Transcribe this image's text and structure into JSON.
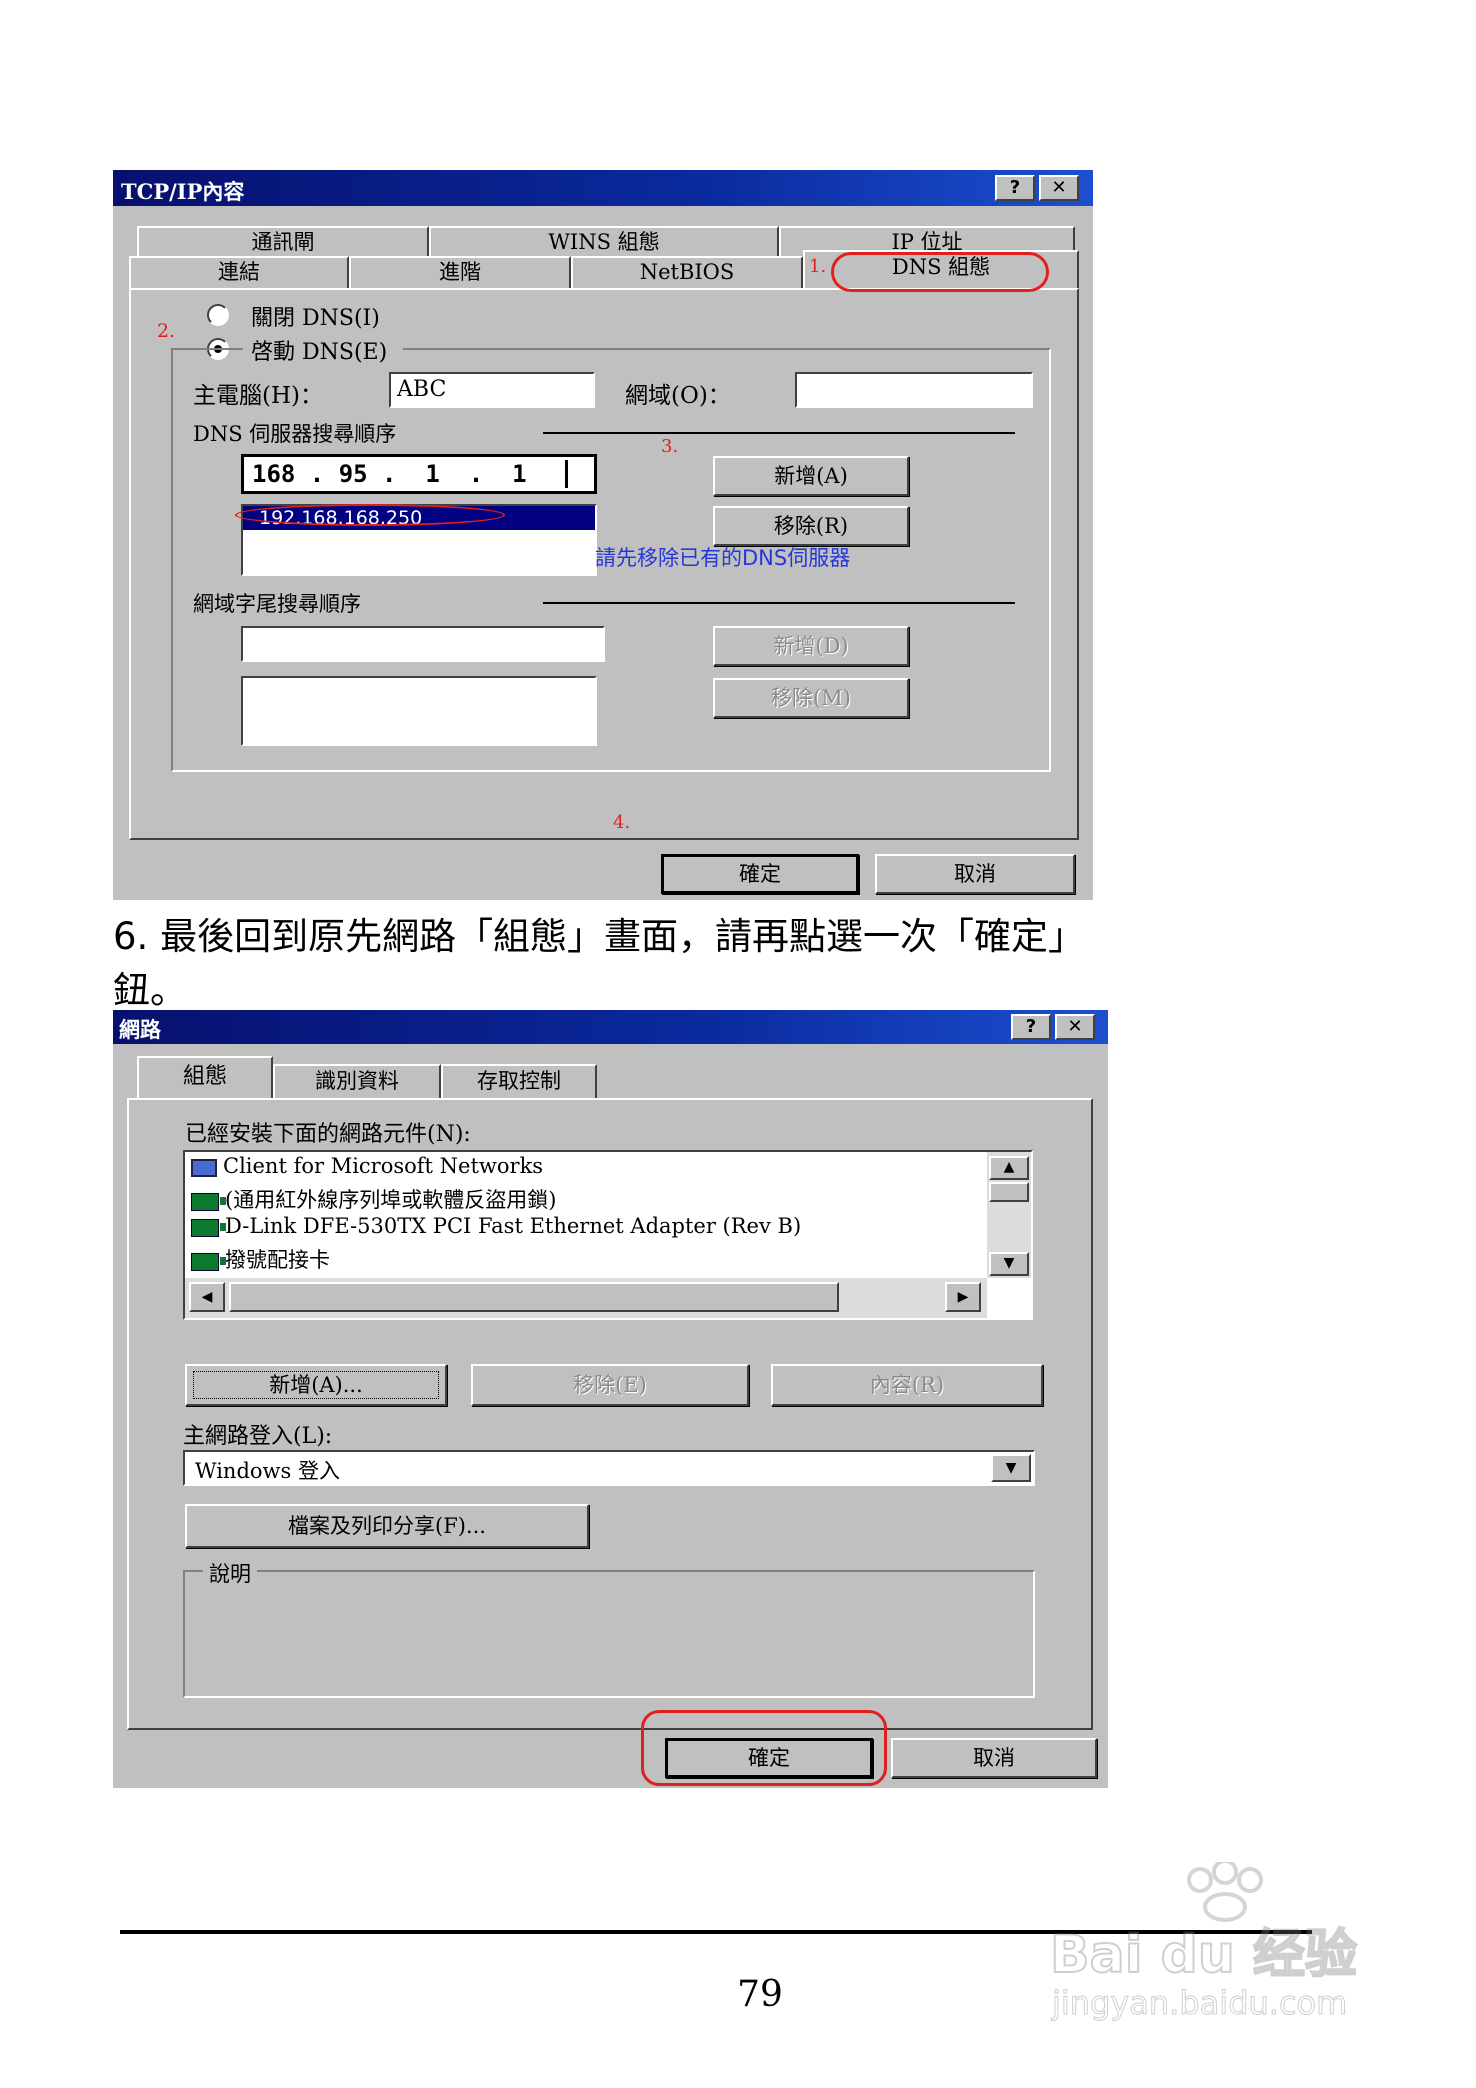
{
  "dialog1": {
    "title": "TCP/IP內容",
    "help": "?",
    "close": "✕",
    "tabs_back": [
      "通訊閘",
      "WINS 組態",
      "IP 位址"
    ],
    "tabs_front": [
      "連結",
      "進階",
      "NetBIOS",
      "DNS 組態"
    ],
    "disable_dns": "關閉 DNS(I)",
    "enable_dns": "啓動 DNS(E)",
    "host_label": "主電腦(H)：",
    "host_value": "ABC",
    "domain_label": "網域(O)：",
    "domain_value": "",
    "dns_order_label": "DNS 伺服器搜尋順序",
    "dns_input": "168 . 95 .  1  .  1",
    "dns_list": [
      "192.168.168.250"
    ],
    "add_button": "新增(A)",
    "remove_button": "移除(R)",
    "note": "請先移除已有的DNS伺服器",
    "suffix_label": "網域字尾搜尋順序",
    "suffix_input": "",
    "suffix_add": "新增(D)",
    "suffix_remove": "移除(M)",
    "ok": "確定",
    "cancel": "取消",
    "step1": "1.",
    "step2": "2.",
    "step3": "3.",
    "step4": "4."
  },
  "instruction_line1": "6. 最後回到原先網路「組態」畫面，請再點選一次「確定」",
  "instruction_line2": "鈕。",
  "dialog2": {
    "title": "網路",
    "help": "?",
    "close": "✕",
    "tabs": [
      "組態",
      "識別資料",
      "存取控制"
    ],
    "components_label": "已經安裝下面的網路元件(N):",
    "components": [
      "Client for Microsoft Networks",
      "(通用紅外線序列埠或軟體反盜用鎖)",
      "D-Link DFE-530TX PCI Fast Ethernet Adapter (Rev B)",
      "撥號配接卡"
    ],
    "add_button": "新增(A)...",
    "remove_button": "移除(E)",
    "properties_button": "內容(R)",
    "logon_label": "主網路登入(L):",
    "logon_value": "Windows 登入",
    "share_button": "檔案及列印分享(F)...",
    "description_label": "說明",
    "ok": "確定",
    "cancel": "取消"
  },
  "page_number": "79",
  "watermark_brand": "Bai du 经验",
  "watermark_url": "jingyan.baidu.com"
}
